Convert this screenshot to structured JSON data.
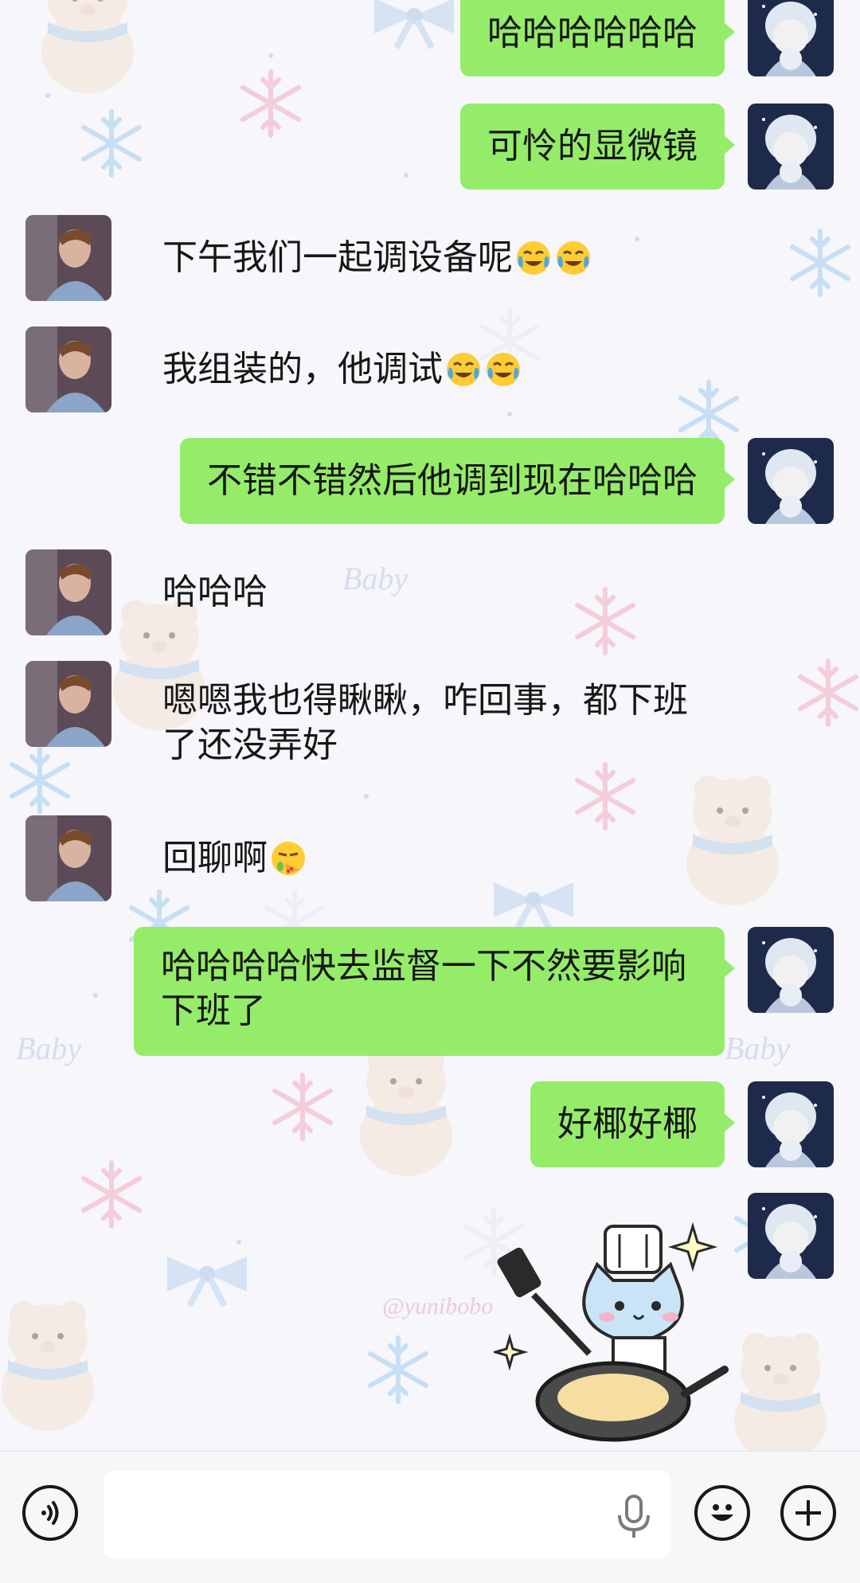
{
  "messages": [
    {
      "sender": "self",
      "text": "哈哈哈哈哈哈"
    },
    {
      "sender": "self",
      "text": "可怜的显微镜"
    },
    {
      "sender": "other",
      "text": "下午我们一起调设备呢",
      "emoji": [
        "face-with-tears-of-joy",
        "face-with-tears-of-joy"
      ]
    },
    {
      "sender": "other",
      "text": "我组装的，他调试",
      "emoji": [
        "face-with-tears-of-joy",
        "face-with-tears-of-joy"
      ]
    },
    {
      "sender": "self",
      "text": "不错不错然后他调到现在哈哈哈"
    },
    {
      "sender": "other",
      "text": "哈哈哈"
    },
    {
      "sender": "other",
      "text": "嗯嗯我也得瞅瞅，咋回事，都下班了还没弄好"
    },
    {
      "sender": "other",
      "text": "回聊啊",
      "emoji": [
        "drooling-face-with-pizza"
      ]
    },
    {
      "sender": "self",
      "text": "哈哈哈哈快去监督一下不然要影响下班了"
    },
    {
      "sender": "self",
      "text": "好椰好椰"
    },
    {
      "sender": "self",
      "sticker": "cat-chef-frying-pan-sticker"
    }
  ],
  "wallpaper_watermark": "@yunibobo",
  "wallpaper_text": "Baby",
  "input_bar": {
    "placeholder": "",
    "icons": [
      "voice-icon",
      "microphone-icon",
      "emoji-icon",
      "plus-icon"
    ]
  },
  "colors": {
    "self_bubble": "#95ec69",
    "other_bubble": "transparent",
    "input_bar_bg": "#f7f7f7"
  }
}
